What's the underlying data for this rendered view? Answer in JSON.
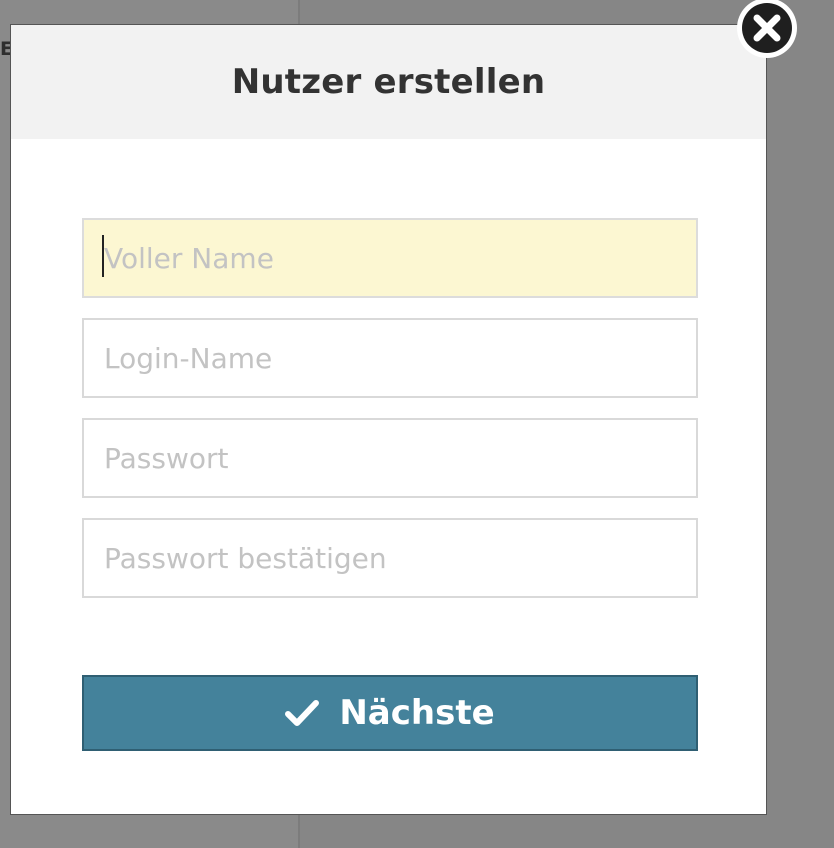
{
  "background": {
    "fragment_text": "E"
  },
  "modal": {
    "title": "Nutzer erstellen",
    "fields": [
      {
        "name": "full-name",
        "placeholder": "Voller Name",
        "value": "",
        "focused": true
      },
      {
        "name": "login-name",
        "placeholder": "Login-Name",
        "value": ""
      },
      {
        "name": "password",
        "placeholder": "Passwort",
        "value": ""
      },
      {
        "name": "password-confirm",
        "placeholder": "Passwort bestätigen",
        "value": ""
      }
    ],
    "submit_label": "Nächste",
    "submit_icon": "check-icon",
    "close_icon": "close-icon"
  },
  "colors": {
    "accent": "#44829b",
    "focused_field_bg": "#fcf7d2",
    "header_bg": "#f2f2f2",
    "overlay": "#868686"
  }
}
